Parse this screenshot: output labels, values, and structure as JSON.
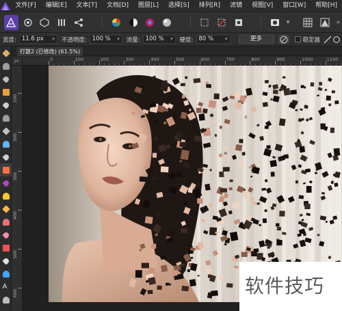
{
  "menu": {
    "items": [
      "文件[F]",
      "编辑[E]",
      "文本[T]",
      "文档[D]",
      "图层[L]",
      "选择[S]",
      "排列[R]",
      "滤镜",
      "视图[V]",
      "窗口[W]",
      "帮助[H]"
    ]
  },
  "toolbar": {
    "personas": [
      "photo-persona",
      "liquify-persona",
      "develop-persona",
      "tone-mapping-persona",
      "export-persona"
    ],
    "tools": [
      "color-wheel-icon",
      "contrast-icon",
      "color-mode-icon",
      "sphere-icon",
      "marquee-icon",
      "no-selection-icon",
      "invert-icon",
      "circle-mask-icon"
    ]
  },
  "context": {
    "width_label": "宽度:",
    "width_value": "11.6 px",
    "opacity_label": "不透明度:",
    "opacity_value": "100 %",
    "flow_label": "流量:",
    "flow_value": "100 %",
    "hardness_label": "硬度:",
    "hardness_value": "80 %",
    "more_label": "更多",
    "stabilizer_label": "稳定器"
  },
  "document": {
    "tab_title": "打散2 (已修改) (61.5%)"
  },
  "ruler": {
    "unit": "px",
    "h_ticks": [
      "0",
      "100",
      "200",
      "300",
      "400",
      "500",
      "600",
      "700",
      "800",
      "900",
      "1000",
      "1100"
    ],
    "v_ticks": [
      "100",
      "200",
      "300",
      "400",
      "500",
      "600"
    ]
  },
  "watermark": {
    "text": "软件技巧"
  },
  "colors": {
    "accent": "#5b3fa8",
    "background": "#262626",
    "canvas_bg": "#202020"
  }
}
